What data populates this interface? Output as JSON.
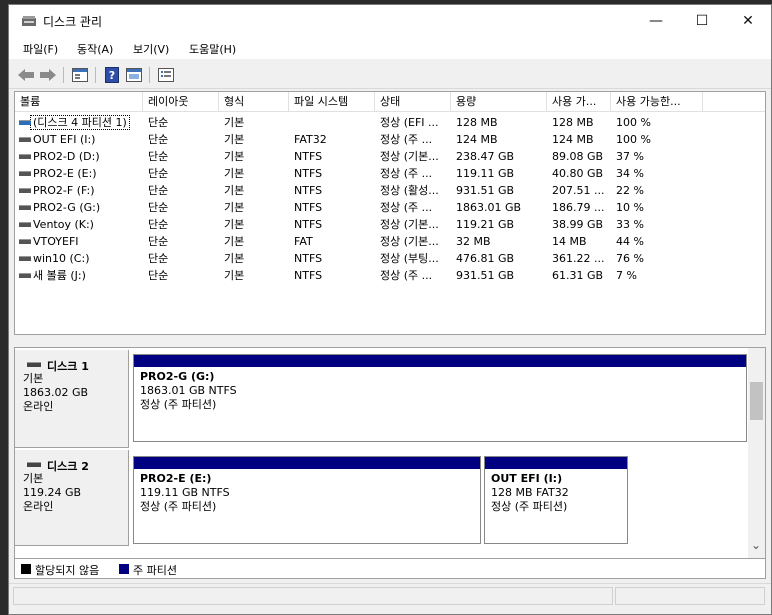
{
  "window": {
    "title": "디스크 관리",
    "minimize_glyph": "—",
    "maximize_glyph": "☐",
    "close_glyph": "✕"
  },
  "menu": [
    "파일(F)",
    "동작(A)",
    "보기(V)",
    "도움말(H)"
  ],
  "toolbar": {
    "icons": [
      "back-arrow-icon",
      "forward-arrow-icon",
      "disk-list-icon",
      "help-icon",
      "properties-icon",
      "settings-icon"
    ]
  },
  "table": {
    "columns": [
      "볼륨",
      "레이아웃",
      "형식",
      "파일 시스템",
      "상태",
      "용량",
      "사용 가...",
      "사용 가능한..."
    ],
    "rows": [
      {
        "volume": "(디스크 4 파티션 1)",
        "layout": "단순",
        "type": "기본",
        "fs": "",
        "status": "정상 (EFI ...",
        "capacity": "128 MB",
        "free": "128 MB",
        "pct": "100 %"
      },
      {
        "volume": "OUT EFI (I:)",
        "layout": "단순",
        "type": "기본",
        "fs": "FAT32",
        "status": "정상 (주 ...",
        "capacity": "124 MB",
        "free": "124 MB",
        "pct": "100 %"
      },
      {
        "volume": "PRO2-D (D:)",
        "layout": "단순",
        "type": "기본",
        "fs": "NTFS",
        "status": "정상 (기본...",
        "capacity": "238.47 GB",
        "free": "89.08 GB",
        "pct": "37 %"
      },
      {
        "volume": "PRO2-E (E:)",
        "layout": "단순",
        "type": "기본",
        "fs": "NTFS",
        "status": "정상 (주 ...",
        "capacity": "119.11 GB",
        "free": "40.80 GB",
        "pct": "34 %"
      },
      {
        "volume": "PRO2-F (F:)",
        "layout": "단순",
        "type": "기본",
        "fs": "NTFS",
        "status": "정상 (활성...",
        "capacity": "931.51 GB",
        "free": "207.51 ...",
        "pct": "22 %"
      },
      {
        "volume": "PRO2-G (G:)",
        "layout": "단순",
        "type": "기본",
        "fs": "NTFS",
        "status": "정상 (주 ...",
        "capacity": "1863.01 GB",
        "free": "186.79 ...",
        "pct": "10 %"
      },
      {
        "volume": "Ventoy (K:)",
        "layout": "단순",
        "type": "기본",
        "fs": "NTFS",
        "status": "정상 (기본...",
        "capacity": "119.21 GB",
        "free": "38.99 GB",
        "pct": "33 %"
      },
      {
        "volume": "VTOYEFI",
        "layout": "단순",
        "type": "기본",
        "fs": "FAT",
        "status": "정상 (기본...",
        "capacity": "32 MB",
        "free": "14 MB",
        "pct": "44 %"
      },
      {
        "volume": "win10 (C:)",
        "layout": "단순",
        "type": "기본",
        "fs": "NTFS",
        "status": "정상 (부팅...",
        "capacity": "476.81 GB",
        "free": "361.22 ...",
        "pct": "76 %"
      },
      {
        "volume": "새 볼륨 (J:)",
        "layout": "단순",
        "type": "기본",
        "fs": "NTFS",
        "status": "정상 (주 ...",
        "capacity": "931.51 GB",
        "free": "61.31 GB",
        "pct": "7 %"
      }
    ]
  },
  "disks": [
    {
      "name": "디스크 1",
      "kind": "기본",
      "size": "1863.02 GB",
      "state": "온라인",
      "partitions": [
        {
          "name": "PRO2-G  (G:)",
          "size": "1863.01 GB NTFS",
          "status": "정상 (주 파티션)"
        }
      ]
    },
    {
      "name": "디스크 2",
      "kind": "기본",
      "size": "119.24 GB",
      "state": "온라인",
      "partitions": [
        {
          "name": "PRO2-E  (E:)",
          "size": "119.11 GB NTFS",
          "status": "정상 (주 파티션)"
        },
        {
          "name": "OUT EFI  (I:)",
          "size": "128 MB FAT32",
          "status": "정상 (주 파티션)"
        }
      ]
    }
  ],
  "legend": [
    {
      "label": "할당되지 않음",
      "color": "#000000"
    },
    {
      "label": "주 파티션",
      "color": "#000080"
    }
  ],
  "scroll_down_glyph": "⌄"
}
